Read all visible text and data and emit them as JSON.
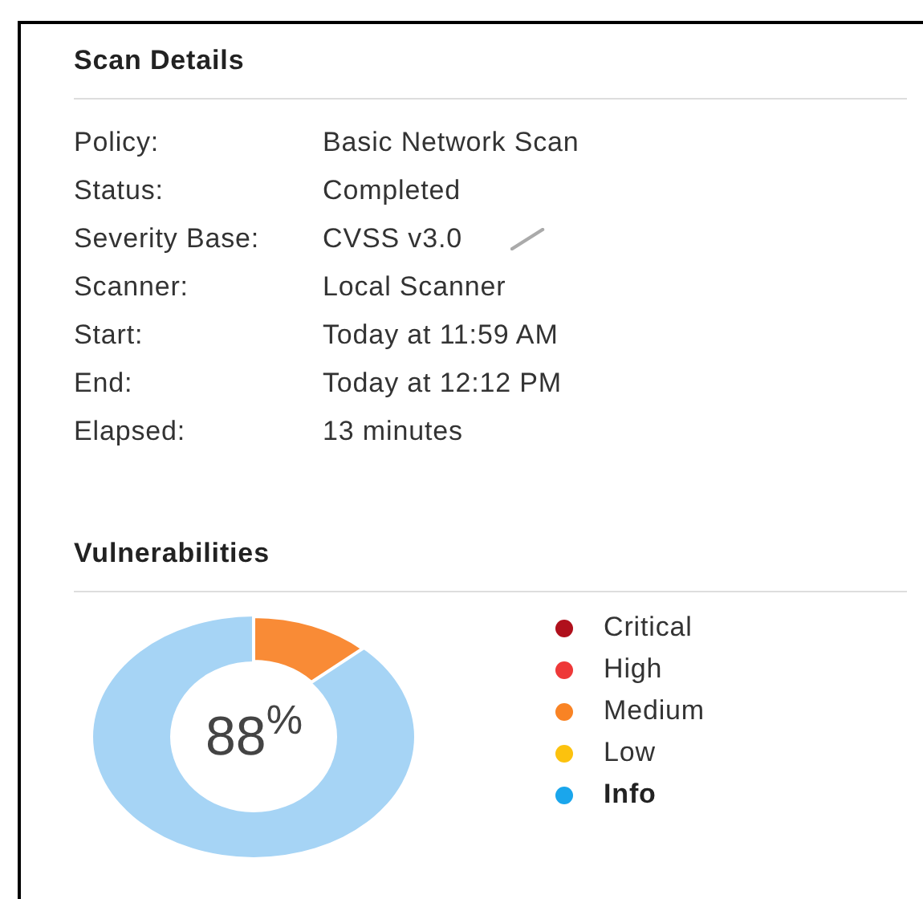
{
  "scan_details": {
    "title": "Scan Details",
    "rows": [
      {
        "label": "Policy:",
        "value": "Basic Network Scan",
        "editable": false
      },
      {
        "label": "Status:",
        "value": "Completed",
        "editable": false
      },
      {
        "label": "Severity Base:",
        "value": "CVSS v3.0",
        "editable": true
      },
      {
        "label": "Scanner:",
        "value": "Local Scanner",
        "editable": false
      },
      {
        "label": "Start:",
        "value": "Today at 11:59 AM",
        "editable": false
      },
      {
        "label": "End:",
        "value": "Today at 12:12 PM",
        "editable": false
      },
      {
        "label": "Elapsed:",
        "value": "13 minutes",
        "editable": false
      }
    ]
  },
  "vulnerabilities": {
    "title": "Vulnerabilities",
    "center_label": "88$^{%}$",
    "legend": [
      {
        "label": "Critical",
        "color": "#b0101c",
        "selected": false
      },
      {
        "label": "High",
        "color": "#ee3838",
        "selected": false
      },
      {
        "label": "Medium",
        "color": "#f98324",
        "selected": false
      },
      {
        "label": "Low",
        "color": "#fcc20e",
        "selected": false
      },
      {
        "label": "Info",
        "color": "#1aa6ec",
        "selected": true
      }
    ]
  }
}
